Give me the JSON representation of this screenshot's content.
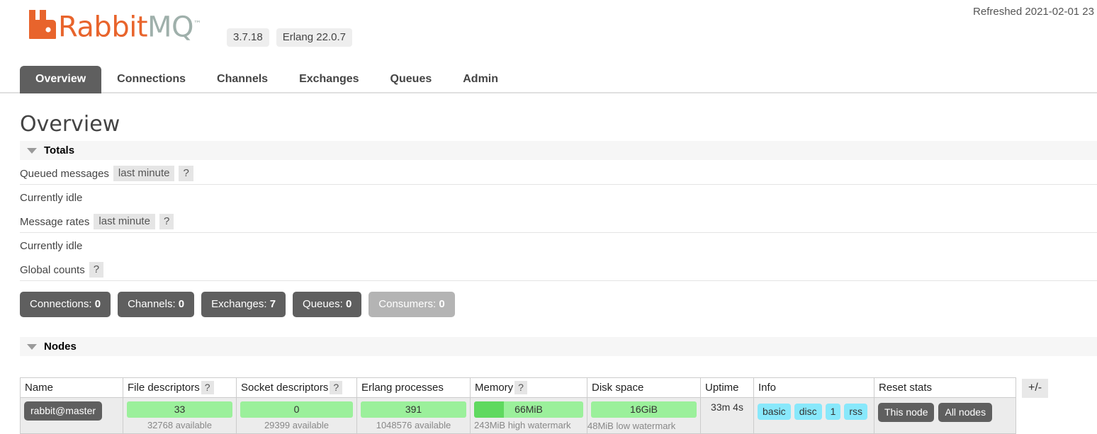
{
  "header": {
    "logo_text_primary": "Rabbit",
    "logo_text_secondary": "MQ",
    "logo_tm": "™",
    "version": "3.7.18",
    "erlang_version": "Erlang 22.0.7",
    "refreshed": "Refreshed 2021-02-01 23"
  },
  "nav": {
    "tabs": [
      {
        "label": "Overview",
        "active": true
      },
      {
        "label": "Connections",
        "active": false
      },
      {
        "label": "Channels",
        "active": false
      },
      {
        "label": "Exchanges",
        "active": false
      },
      {
        "label": "Queues",
        "active": false
      },
      {
        "label": "Admin",
        "active": false
      }
    ]
  },
  "page": {
    "title": "Overview"
  },
  "totals": {
    "section_title": "Totals",
    "queued_messages": {
      "label": "Queued messages",
      "period_chip": "last minute",
      "help_chip": "?",
      "status": "Currently idle"
    },
    "message_rates": {
      "label": "Message rates",
      "period_chip": "last minute",
      "help_chip": "?",
      "status": "Currently idle"
    },
    "global_counts": {
      "label": "Global counts",
      "help_chip": "?",
      "buttons": [
        {
          "label": "Connections:",
          "value": "0",
          "muted": false
        },
        {
          "label": "Channels:",
          "value": "0",
          "muted": false
        },
        {
          "label": "Exchanges:",
          "value": "7",
          "muted": false
        },
        {
          "label": "Queues:",
          "value": "0",
          "muted": false
        },
        {
          "label": "Consumers:",
          "value": "0",
          "muted": true
        }
      ]
    }
  },
  "nodes": {
    "section_title": "Nodes",
    "columns": {
      "name": "Name",
      "file_descriptors": "File descriptors",
      "file_descriptors_help": "?",
      "socket_descriptors": "Socket descriptors",
      "socket_descriptors_help": "?",
      "erlang_processes": "Erlang processes",
      "memory": "Memory",
      "memory_help": "?",
      "disk_space": "Disk space",
      "uptime": "Uptime",
      "info": "Info",
      "reset_stats": "Reset stats",
      "plus_minus": "+/-"
    },
    "rows": [
      {
        "name": "rabbit@master",
        "file_descriptors": {
          "value": "33",
          "sub": "32768 available",
          "fill_pct": 0
        },
        "socket_descriptors": {
          "value": "0",
          "sub": "29399 available",
          "fill_pct": 0
        },
        "erlang_processes": {
          "value": "391",
          "sub": "1048576 available",
          "fill_pct": 0
        },
        "memory": {
          "value": "66MiB",
          "sub": "243MiB high watermark",
          "fill_pct": 27
        },
        "disk_space": {
          "value": "16GiB",
          "sub": "48MiB low watermark",
          "fill_pct": 0
        },
        "uptime": "33m 4s",
        "info": [
          "basic",
          "disc",
          "1",
          "rss"
        ],
        "reset_stats": [
          "This node",
          "All nodes"
        ]
      }
    ]
  },
  "colors": {
    "brand_orange": "#e8642c",
    "brand_gray": "#9fb0ab",
    "tab_active_bg": "#5f5f5f",
    "bar_bg": "#9bf09b",
    "bar_fill": "#5fd95f",
    "info_badge": "#88e8fb"
  }
}
